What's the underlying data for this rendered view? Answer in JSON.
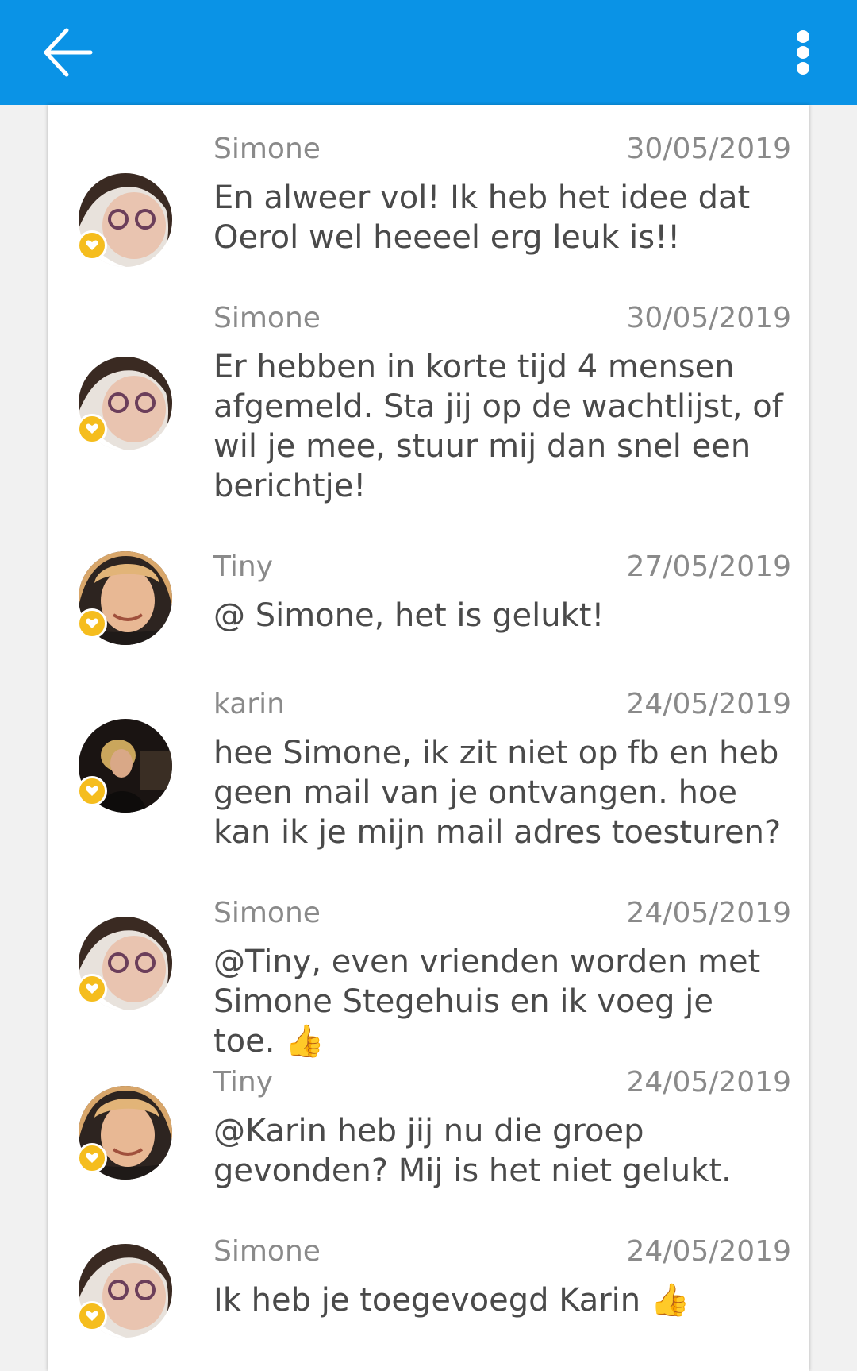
{
  "colors": {
    "app_bar": "#0a93e6",
    "badge": "#f5bd1e",
    "name_date_text": "#8a8a8a",
    "message_text": "#4a4a4a"
  },
  "header": {
    "back_icon": "arrow-left-icon",
    "menu_icon": "more-vertical-icon"
  },
  "messages": [
    {
      "name": "Simone",
      "date": "30/05/2019",
      "text": "En alweer vol! Ik heb het idee dat Oerol wel heeeel erg leuk is!!",
      "avatar": "simone"
    },
    {
      "name": "Simone",
      "date": "30/05/2019",
      "text": "Er hebben in korte tijd 4 mensen afgemeld. Sta jij op de wachtlijst, of wil je mee, stuur mij dan snel een berichtje!",
      "avatar": "simone"
    },
    {
      "name": "Tiny",
      "date": "27/05/2019",
      "text": "@ Simone, het is gelukt!",
      "avatar": "tiny"
    },
    {
      "name": "karin",
      "date": "24/05/2019",
      "text": "hee Simone, ik zit niet op fb en heb geen mail van je ontvangen. hoe kan ik je mijn mail adres toesturen?",
      "avatar": "karin"
    },
    {
      "name": "Simone",
      "date": "24/05/2019",
      "text": "@Tiny, even vrienden worden met Simone Stegehuis en ik voeg je toe. 👍",
      "avatar": "simone"
    },
    {
      "name": "Tiny",
      "date": "24/05/2019",
      "text": "@Karin   heb jij nu die groep gevonden? Mij is het niet gelukt.",
      "avatar": "tiny"
    },
    {
      "name": "Simone",
      "date": "24/05/2019",
      "text": "Ik heb je toegevoegd Karin 👍",
      "avatar": "simone"
    }
  ]
}
